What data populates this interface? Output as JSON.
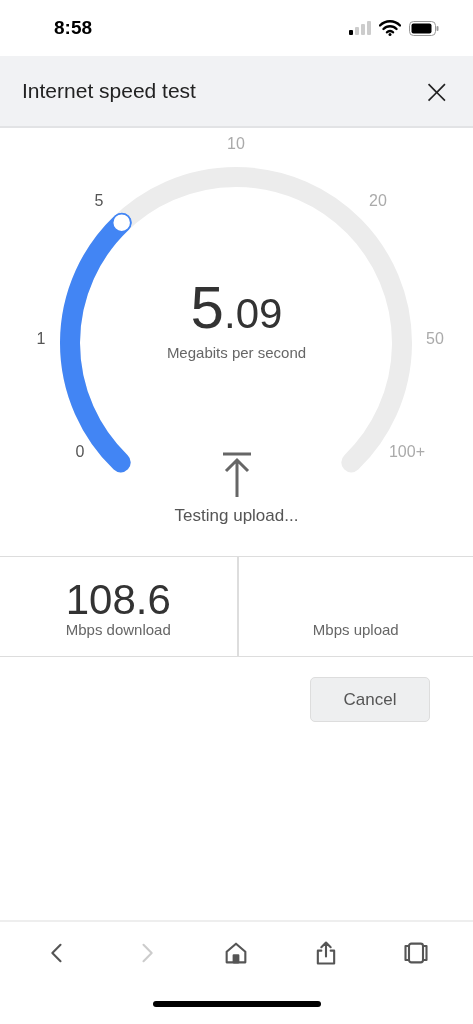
{
  "status_bar": {
    "time": "8:58"
  },
  "header": {
    "title": "Internet speed test",
    "close": "×"
  },
  "gauge": {
    "ticks": [
      "0",
      "1",
      "5",
      "10",
      "20",
      "50",
      "100+"
    ],
    "reading_whole": "5",
    "reading_fraction": ".09",
    "unit": "Megabits per second",
    "status": "Testing upload..."
  },
  "results": [
    {
      "value": "108.6",
      "label": "Mbps download"
    },
    {
      "label": "Mbps upload"
    }
  ],
  "buttons": [
    {
      "label": "Cancel"
    }
  ],
  "toolbar": [
    {
      "kind": "back",
      "disabled": false
    },
    {
      "kind": "forward",
      "disabled": true
    },
    {
      "kind": "home",
      "disabled": false
    },
    {
      "kind": "share",
      "disabled": false
    },
    {
      "kind": "tabs",
      "disabled": false
    }
  ]
}
